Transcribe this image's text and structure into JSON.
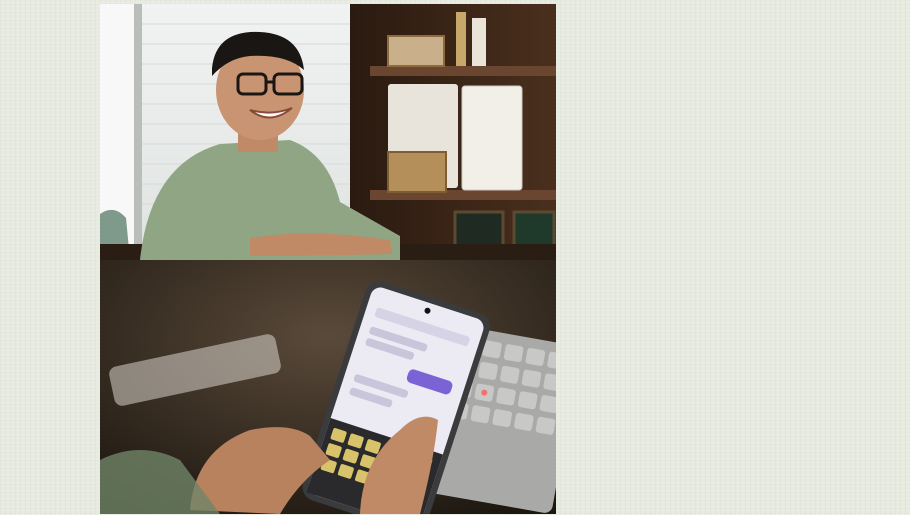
{
  "background": {
    "color": "#e7eadf"
  },
  "photos": [
    {
      "id": "top",
      "subject": "man-smiling-glasses-green-shirt"
    },
    {
      "id": "bottom",
      "subject": "hands-typing-on-smartphone-near-keyboard"
    }
  ],
  "colors": {
    "shirt": "#8fa583",
    "skin": "#c08a66",
    "shelf_wood": "#4a2f1d",
    "phone_ui": "#eceaf3",
    "phone_accent": "#7b63d6",
    "phone_keys": "#d9c36a"
  }
}
